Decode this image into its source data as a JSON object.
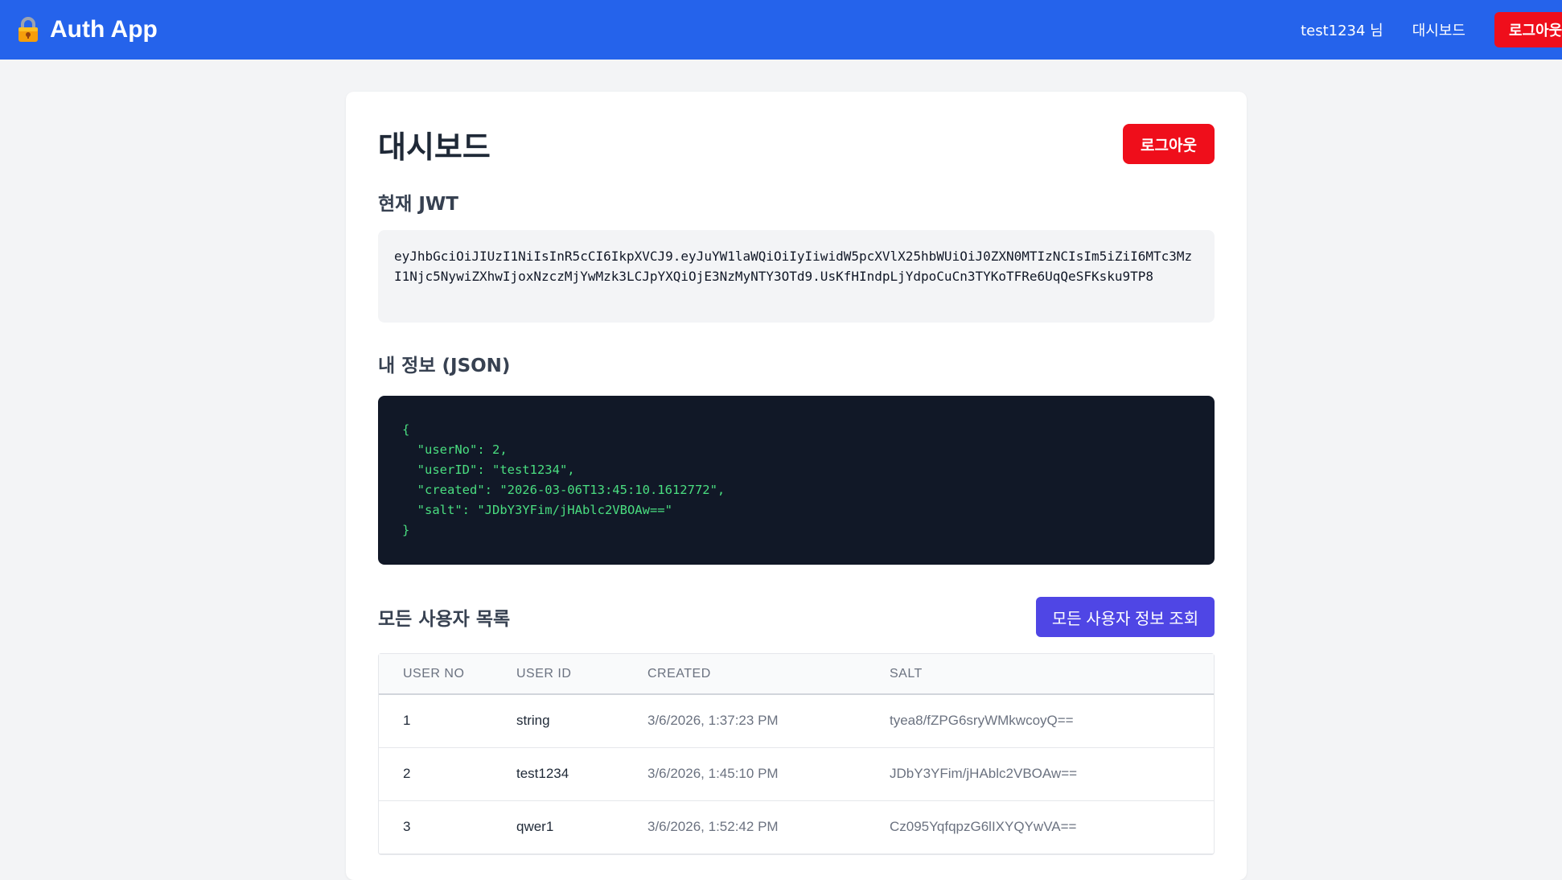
{
  "navbar": {
    "title": "Auth App",
    "user_label": "test1234 님",
    "dashboard_link": "대시보드",
    "logout_label": "로그아웃"
  },
  "page": {
    "title": "대시보드",
    "logout_label": "로그아웃"
  },
  "jwt": {
    "heading": "현재 JWT",
    "token": "eyJhbGciOiJIUzI1NiIsInR5cCI6IkpXVCJ9.eyJuYW1laWQiOiIyIiwidW5pcXVlX25hbWUiOiJ0ZXN0MTIzNCIsIm5iZiI6MTc3MzI1Njc5NywiZXhwIjoxNzczMjYwMzk3LCJpYXQiOjE3NzMyNTY3OTd9.UsKfHIndpLjYdpoCuCn3TYKoTFRe6UqQeSFKsku9TP8"
  },
  "my_info": {
    "heading": "내 정보 (JSON)",
    "json_text": "{\n  \"userNo\": 2,\n  \"userID\": \"test1234\",\n  \"created\": \"2026-03-06T13:45:10.1612772\",\n  \"salt\": \"JDbY3YFim/jHAblc2VBOAw==\"\n}"
  },
  "users": {
    "heading": "모든 사용자 목록",
    "fetch_button": "모든 사용자 정보 조회",
    "columns": [
      "USER NO",
      "USER ID",
      "CREATED",
      "SALT"
    ],
    "rows": [
      [
        "1",
        "string",
        "3/6/2026, 1:37:23 PM",
        "tyea8/fZPG6sryWMkwcoyQ=="
      ],
      [
        "2",
        "test1234",
        "3/6/2026, 1:45:10 PM",
        "JDbY3YFim/jHAblc2VBOAw=="
      ],
      [
        "3",
        "qwer1",
        "3/6/2026, 1:52:42 PM",
        "Cz095YqfqpzG6lIXYQYwVA=="
      ]
    ]
  },
  "icons": {
    "brand": "lock-icon"
  },
  "colors": {
    "navbar": "#2563eb",
    "danger": "#ef0e1b",
    "primary_button": "#4f46e5",
    "code_bg": "#111827",
    "code_text": "#4ade80"
  }
}
